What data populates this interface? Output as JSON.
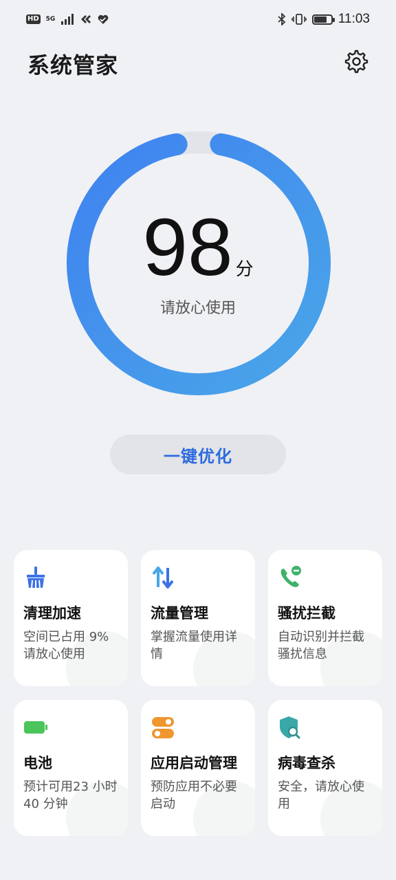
{
  "status_bar": {
    "hd": "HD",
    "network": "5G",
    "time": "11:03"
  },
  "header": {
    "title": "系统管家",
    "settings_icon": "gear-icon"
  },
  "score": {
    "value": "98",
    "unit": "分",
    "message": "请放心使用",
    "ring_fraction": 0.98,
    "ring_color_start": "#3f82f0",
    "ring_color_end": "#4aa6e8"
  },
  "optimize_button": {
    "label": "一键优化"
  },
  "cards": [
    {
      "icon": "broom-icon",
      "title": "清理加速",
      "desc": "空间已占用 9% 请放心使用",
      "accent": "#3c72e6"
    },
    {
      "icon": "traffic-arrows-icon",
      "title": "流量管理",
      "desc": "掌握流量使用详情",
      "accent": "#46a6e8"
    },
    {
      "icon": "phone-block-icon",
      "title": "骚扰拦截",
      "desc": "自动识别并拦截骚扰信息",
      "accent": "#3cb36a"
    },
    {
      "icon": "battery-icon",
      "title": "电池",
      "desc": "预计可用23 小时 40 分钟",
      "accent": "#4cc45c"
    },
    {
      "icon": "toggle-switch-icon",
      "title": "应用启动管理",
      "desc": "预防应用不必要启动",
      "accent": "#f0962e"
    },
    {
      "icon": "shield-search-icon",
      "title": "病毒查杀",
      "desc": "安全，请放心使用",
      "accent": "#3aa7a8"
    }
  ]
}
